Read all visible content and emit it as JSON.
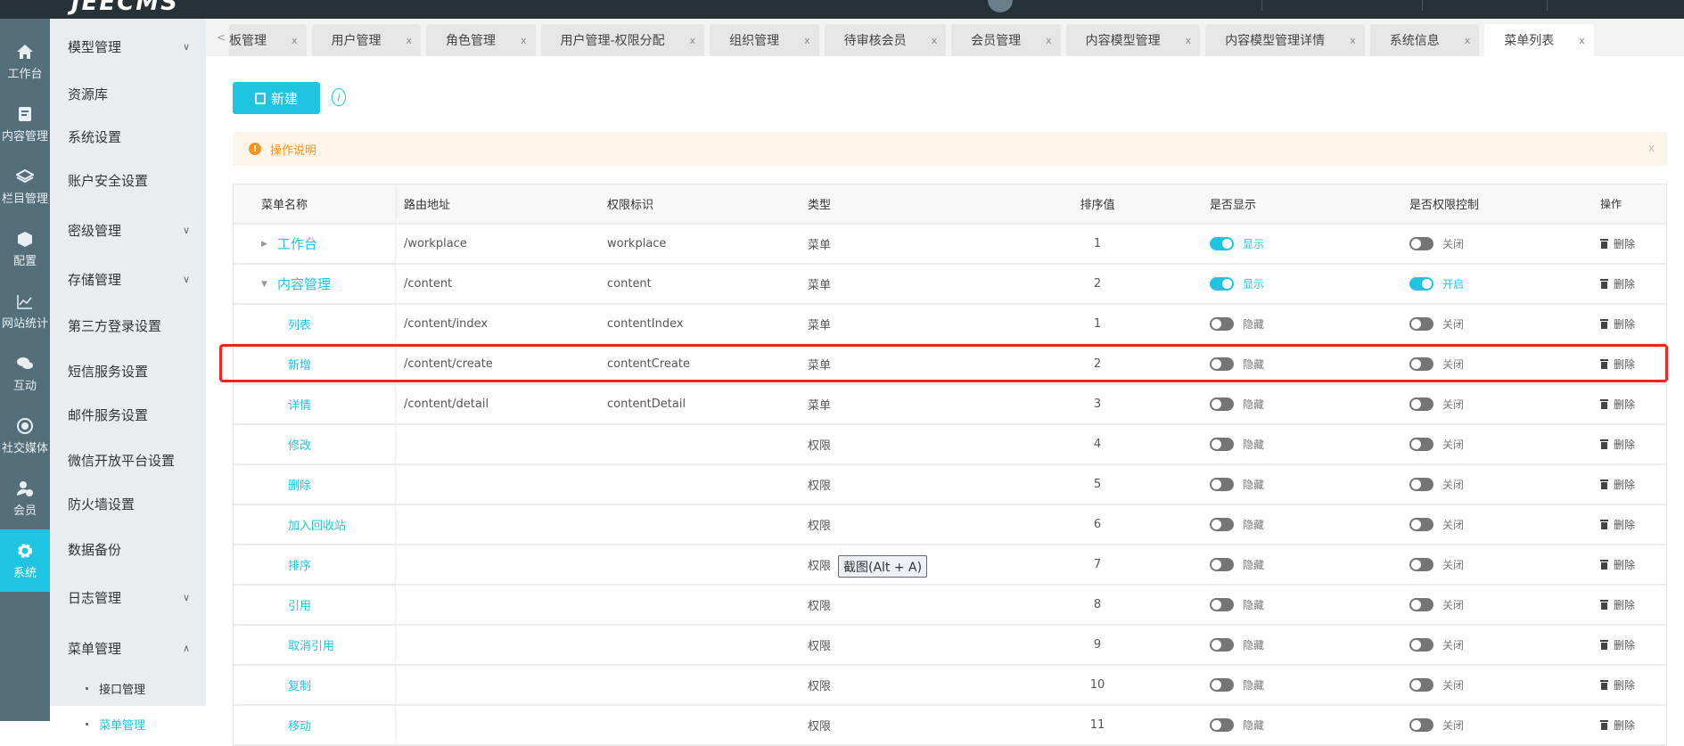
{
  "topbar": {
    "logo": "JEECMS"
  },
  "iconbar": [
    {
      "label": "工作台",
      "icon": "home-icon"
    },
    {
      "label": "内容管理",
      "icon": "edit-doc-icon"
    },
    {
      "label": "栏目管理",
      "icon": "layers-icon"
    },
    {
      "label": "配置",
      "icon": "box-icon"
    },
    {
      "label": "网站统计",
      "icon": "chart-icon"
    },
    {
      "label": "互动",
      "icon": "chat-icon"
    },
    {
      "label": "社交媒体",
      "icon": "target-icon"
    },
    {
      "label": "会员",
      "icon": "user-check-icon"
    },
    {
      "label": "系统",
      "icon": "gear-icon",
      "active": true
    }
  ],
  "submenu": [
    {
      "label": "模型管理",
      "chev": "∨"
    },
    {
      "label": "资源库"
    },
    {
      "label": "系统设置"
    },
    {
      "label": "账户安全设置"
    },
    {
      "label": "密级管理",
      "chev": "∨"
    },
    {
      "label": "存储管理",
      "chev": "∨"
    },
    {
      "label": "第三方登录设置"
    },
    {
      "label": "短信服务设置"
    },
    {
      "label": "邮件服务设置"
    },
    {
      "label": "微信开放平台设置"
    },
    {
      "label": "防火墙设置"
    },
    {
      "label": "数据备份"
    },
    {
      "label": "日志管理",
      "chev": "∨"
    },
    {
      "label": "菜单管理",
      "chev": "∧"
    }
  ],
  "submenu_children": [
    {
      "label": "接口管理"
    },
    {
      "label": "菜单管理",
      "active": true
    }
  ],
  "tabs": [
    {
      "label": "板管理"
    },
    {
      "label": "用户管理"
    },
    {
      "label": "角色管理"
    },
    {
      "label": "用户管理-权限分配"
    },
    {
      "label": "组织管理"
    },
    {
      "label": "待审核会员"
    },
    {
      "label": "会员管理"
    },
    {
      "label": "内容模型管理"
    },
    {
      "label": "内容模型管理详情"
    },
    {
      "label": "系统信息"
    },
    {
      "label": "菜单列表",
      "active": true
    }
  ],
  "tab_close": "x",
  "tab_prev": "<",
  "toolbar": {
    "new_label": "新建",
    "info": "i"
  },
  "alert": {
    "text": "操作说明",
    "icon": "!",
    "close": "x"
  },
  "table": {
    "headers": [
      "菜单名称",
      "路由地址",
      "权限标识",
      "类型",
      "排序值",
      "是否显示",
      "是否权限控制",
      "操作"
    ],
    "delete_label": "删除",
    "rows": [
      {
        "name": "工作台",
        "level": 0,
        "expand": "▶",
        "route": "/workplace",
        "perm": "workplace",
        "type": "菜单",
        "sort": "1",
        "show": true,
        "show_label": "显示",
        "ctrl": false,
        "ctrl_label": "关闭"
      },
      {
        "name": "内容管理",
        "level": 0,
        "expand": "▼",
        "route": "/content",
        "perm": "content",
        "type": "菜单",
        "sort": "2",
        "show": true,
        "show_label": "显示",
        "ctrl": true,
        "ctrl_label": "开启"
      },
      {
        "name": "列表",
        "level": 1,
        "route": "/content/index",
        "perm": "contentIndex",
        "type": "菜单",
        "sort": "1",
        "show": false,
        "show_label": "隐藏",
        "ctrl": false,
        "ctrl_label": "关闭"
      },
      {
        "name": "新增",
        "level": 1,
        "route": "/content/create",
        "perm": "contentCreate",
        "type": "菜单",
        "sort": "2",
        "show": false,
        "show_label": "隐藏",
        "ctrl": false,
        "ctrl_label": "关闭"
      },
      {
        "name": "详情",
        "level": 1,
        "route": "/content/detail",
        "perm": "contentDetail",
        "type": "菜单",
        "sort": "3",
        "show": false,
        "show_label": "隐藏",
        "ctrl": false,
        "ctrl_label": "关闭"
      },
      {
        "name": "修改",
        "level": 1,
        "route": "",
        "perm": "",
        "type": "权限",
        "sort": "4",
        "show": false,
        "show_label": "隐藏",
        "ctrl": false,
        "ctrl_label": "关闭"
      },
      {
        "name": "删除",
        "level": 1,
        "route": "",
        "perm": "",
        "type": "权限",
        "sort": "5",
        "show": false,
        "show_label": "隐藏",
        "ctrl": false,
        "ctrl_label": "关闭"
      },
      {
        "name": "加入回收站",
        "level": 1,
        "route": "",
        "perm": "",
        "type": "权限",
        "sort": "6",
        "show": false,
        "show_label": "隐藏",
        "ctrl": false,
        "ctrl_label": "关闭"
      },
      {
        "name": "排序",
        "level": 1,
        "route": "",
        "perm": "",
        "type": "权限",
        "sort": "7",
        "show": false,
        "show_label": "隐藏",
        "ctrl": false,
        "ctrl_label": "关闭"
      },
      {
        "name": "引用",
        "level": 1,
        "route": "",
        "perm": "",
        "type": "权限",
        "sort": "8",
        "show": false,
        "show_label": "隐藏",
        "ctrl": false,
        "ctrl_label": "关闭"
      },
      {
        "name": "取消引用",
        "level": 1,
        "route": "",
        "perm": "",
        "type": "权限",
        "sort": "9",
        "show": false,
        "show_label": "隐藏",
        "ctrl": false,
        "ctrl_label": "关闭"
      },
      {
        "name": "复制",
        "level": 1,
        "route": "",
        "perm": "",
        "type": "权限",
        "sort": "10",
        "show": false,
        "show_label": "隐藏",
        "ctrl": false,
        "ctrl_label": "关闭"
      },
      {
        "name": "移动",
        "level": 1,
        "route": "",
        "perm": "",
        "type": "权限",
        "sort": "11",
        "show": false,
        "show_label": "隐藏",
        "ctrl": false,
        "ctrl_label": "关闭"
      }
    ]
  },
  "tooltip": "截图(Alt + A)",
  "colors": {
    "accent": "#1fc5e0",
    "highlight": "#ff2020",
    "warning": "#f7941d"
  }
}
